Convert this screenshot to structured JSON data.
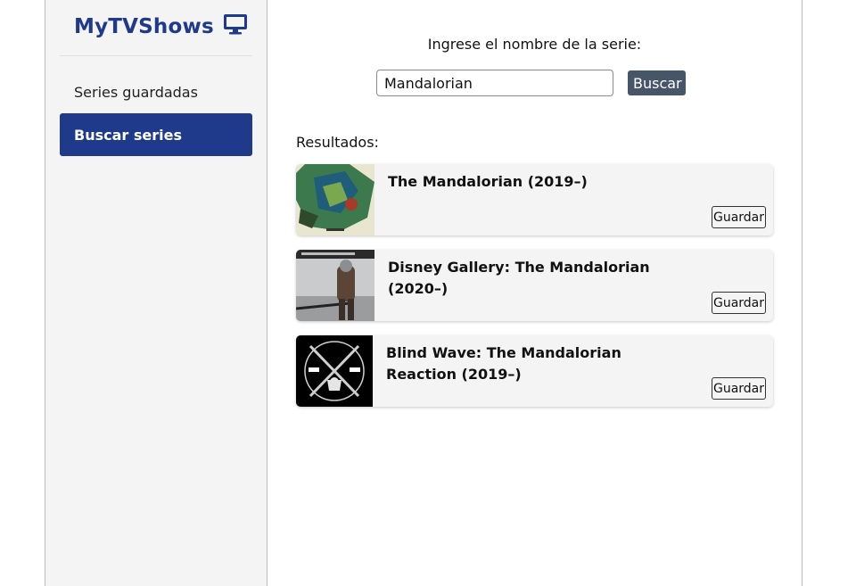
{
  "app": {
    "title": "MyTVShows",
    "brand_color": "#1f3a8a"
  },
  "sidebar": {
    "items": [
      {
        "label": "Series guardadas",
        "active": false
      },
      {
        "label": "Buscar series",
        "active": true
      }
    ]
  },
  "search": {
    "prompt": "Ingrese el nombre de la serie:",
    "value": "Mandalorian",
    "button_label": "Buscar"
  },
  "results": {
    "label": "Resultados:",
    "items": [
      {
        "title": "The Mandalorian (2019–)",
        "save_label": "Guardar",
        "poster": "mandalorian-poster"
      },
      {
        "title": "Disney Gallery: The Mandalorian (2020–)",
        "save_label": "Guardar",
        "poster": "disney-gallery-poster"
      },
      {
        "title": "Blind Wave: The Mandalorian Reaction (2019–)",
        "save_label": "Guardar",
        "poster": "blind-wave-poster"
      }
    ]
  }
}
